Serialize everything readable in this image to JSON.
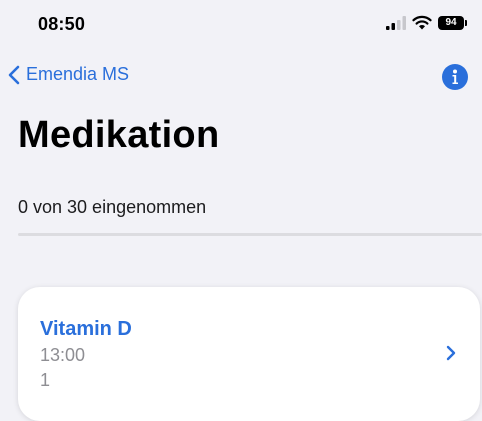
{
  "status_bar": {
    "time": "08:50",
    "battery": "94",
    "signal_icon": "signal-bars-icon",
    "wifi_icon": "wifi-icon"
  },
  "nav": {
    "back_label": "Emendia MS",
    "back_icon": "chevron-left-icon",
    "info_icon": "info-icon"
  },
  "page": {
    "title": "Medikation"
  },
  "progress": {
    "text": "0 von 30 eingenommen",
    "taken": 0,
    "total": 30
  },
  "medications": [
    {
      "name": "Vitamin D",
      "time": "13:00",
      "dose": "1"
    }
  ],
  "colors": {
    "accent": "#2a6fdb",
    "background": "#f2f2f7",
    "secondary_text": "#8e8e93",
    "card": "#ffffff"
  }
}
